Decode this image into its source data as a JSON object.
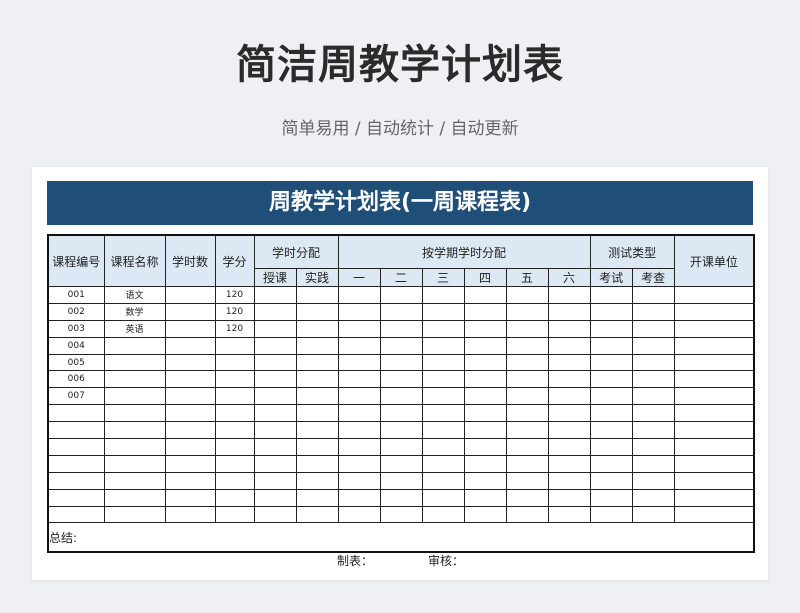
{
  "page": {
    "title": "简洁周教学计划表",
    "subtitle": "简单易用 / 自动统计 / 自动更新"
  },
  "sheet": {
    "banner": "周教学计划表(一周课程表)",
    "headers": {
      "course_code": "课程编号",
      "course_name": "课程名称",
      "hours": "学时数",
      "credits": "学分",
      "hour_split": "学时分配",
      "teaching": "授课",
      "practice": "实践",
      "semester_split": "按学期学时分配",
      "semesters": [
        "一",
        "二",
        "三",
        "四",
        "五",
        "六"
      ],
      "test_type": "测试类型",
      "exam": "考试",
      "check": "考查",
      "department": "开课单位"
    },
    "rows": [
      {
        "code": "001",
        "name": "语文",
        "credits": "120"
      },
      {
        "code": "002",
        "name": "数学",
        "credits": "120"
      },
      {
        "code": "003",
        "name": "英语",
        "credits": "120"
      },
      {
        "code": "004",
        "name": "",
        "credits": ""
      },
      {
        "code": "005",
        "name": "",
        "credits": ""
      },
      {
        "code": "006",
        "name": "",
        "credits": ""
      },
      {
        "code": "007",
        "name": "",
        "credits": ""
      },
      {
        "code": "",
        "name": "",
        "credits": ""
      },
      {
        "code": "",
        "name": "",
        "credits": ""
      },
      {
        "code": "",
        "name": "",
        "credits": ""
      },
      {
        "code": "",
        "name": "",
        "credits": ""
      },
      {
        "code": "",
        "name": "",
        "credits": ""
      },
      {
        "code": "",
        "name": "",
        "credits": ""
      },
      {
        "code": "",
        "name": "",
        "credits": ""
      }
    ],
    "summary_label": "总结:",
    "footer": {
      "prepared_by": "制表：",
      "reviewed_by": "审核："
    }
  }
}
